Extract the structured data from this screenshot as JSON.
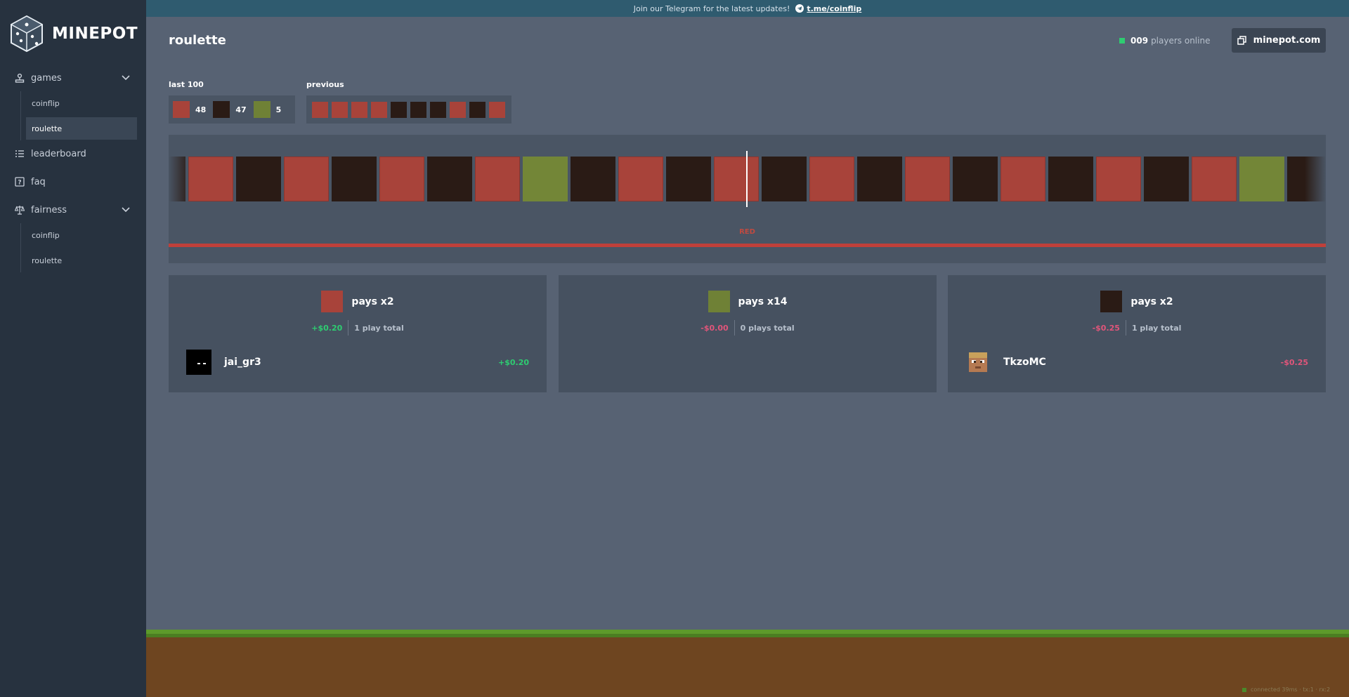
{
  "brand": {
    "name": "MINEPOT"
  },
  "banner": {
    "text": "Join our Telegram for the latest updates!",
    "link": "t.me/coinflip"
  },
  "sidebar": {
    "games": {
      "label": "games",
      "items": [
        {
          "label": "coinflip"
        },
        {
          "label": "roulette"
        }
      ]
    },
    "leaderboard": {
      "label": "leaderboard"
    },
    "faq": {
      "label": "faq"
    },
    "fairness": {
      "label": "fairness",
      "items": [
        {
          "label": "coinflip"
        },
        {
          "label": "roulette"
        }
      ]
    }
  },
  "header": {
    "title": "roulette",
    "online_count": "009",
    "online_label": "players online",
    "site_button": "minepot.com"
  },
  "history": {
    "last100_label": "last 100",
    "last100": {
      "red": "48",
      "black": "47",
      "green": "5"
    },
    "previous_label": "previous",
    "previous": [
      "red",
      "red",
      "red",
      "red",
      "black",
      "black",
      "black",
      "red",
      "black",
      "red"
    ]
  },
  "wheel": {
    "tiles": [
      "black",
      "red",
      "black",
      "red",
      "black",
      "red",
      "black",
      "red",
      "green",
      "black",
      "red",
      "black",
      "red",
      "black",
      "red",
      "black",
      "red",
      "black",
      "red",
      "black",
      "red",
      "black",
      "red",
      "green",
      "black"
    ],
    "result_label": "RED"
  },
  "panels": [
    {
      "color": "red",
      "pays": "pays x2",
      "total": "+$0.20",
      "plays": "1 play total",
      "total_sign": "pos",
      "bets": [
        {
          "name": "jai_gr3",
          "amount": "+$0.20",
          "sign": "pos"
        }
      ]
    },
    {
      "color": "green",
      "pays": "pays x14",
      "total": "-$0.00",
      "plays": "0 plays total",
      "total_sign": "neg",
      "bets": []
    },
    {
      "color": "black",
      "pays": "pays x2",
      "total": "-$0.25",
      "plays": "1 play total",
      "total_sign": "neg",
      "bets": [
        {
          "name": "TkzoMC",
          "amount": "-$0.25",
          "sign": "neg"
        }
      ]
    }
  ],
  "status": {
    "text": "connected 39ms · tx:1 · rx:2"
  },
  "colors": {
    "red": "#a8433a",
    "black": "#2a1b15",
    "green": "#6f8136",
    "positive": "#2ecc71",
    "negative": "#e0557a"
  }
}
